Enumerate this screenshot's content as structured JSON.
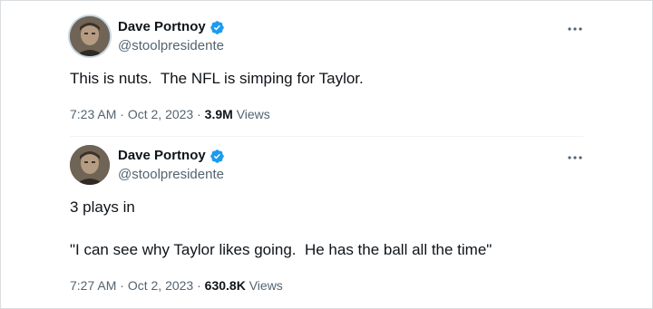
{
  "colors": {
    "text_primary": "#0f1419",
    "text_secondary": "#536471",
    "verified_badge": "#1d9bf0",
    "divider": "#eff3f4"
  },
  "tweets": [
    {
      "author": {
        "display_name": "Dave Portnoy",
        "handle": "@stoolpresidente",
        "verified": true,
        "avatar_icon": "profile-photo"
      },
      "text_lines": [
        "This is nuts.  The NFL is simping for Taylor."
      ],
      "time": "7:23 AM",
      "date": "Oct 2, 2023",
      "separator": "·",
      "views_count": "3.9M",
      "views_label": "Views",
      "more_icon": "more-horizontal-icon"
    },
    {
      "author": {
        "display_name": "Dave Portnoy",
        "handle": "@stoolpresidente",
        "verified": true,
        "avatar_icon": "profile-photo"
      },
      "text_lines": [
        "3 plays in",
        "\"I can see why Taylor likes going.  He has the ball all the time\""
      ],
      "time": "7:27 AM",
      "date": "Oct 2, 2023",
      "separator": "·",
      "views_count": "630.8K",
      "views_label": "Views",
      "more_icon": "more-horizontal-icon"
    }
  ]
}
